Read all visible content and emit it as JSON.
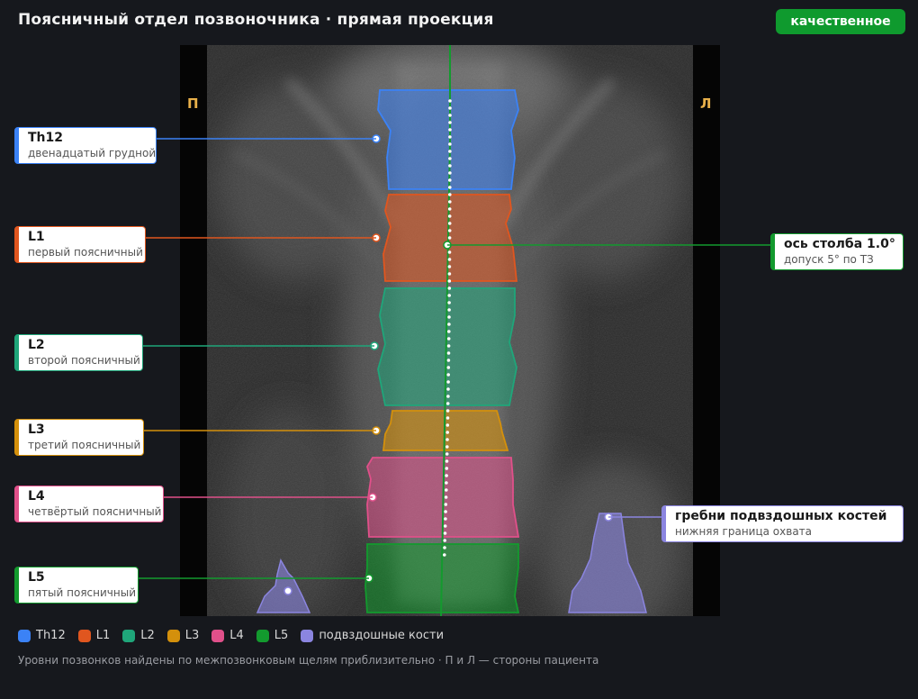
{
  "header": {
    "title": "Поясничный отдел позвоночника · прямая проекция",
    "quality_badge": "качественное"
  },
  "scan": {
    "side_right_label": "П",
    "side_left_label": "Л"
  },
  "vertebrae": [
    {
      "code": "Th12",
      "name": "двенадцатый грудной",
      "color": "#3b82f6"
    },
    {
      "code": "L1",
      "name": "первый поясничный",
      "color": "#e0561f"
    },
    {
      "code": "L2",
      "name": "второй поясничный",
      "color": "#1fa67a"
    },
    {
      "code": "L3",
      "name": "третий поясничный",
      "color": "#d4900c"
    },
    {
      "code": "L4",
      "name": "четвёртый поясничный",
      "color": "#e0508a"
    },
    {
      "code": "L5",
      "name": "пятый поясничный",
      "color": "#139a2e"
    }
  ],
  "axis_callout": {
    "title": "ось столба 1.0°",
    "subtitle": "допуск 5° по ТЗ",
    "color": "#139a2e"
  },
  "iliac_callout": {
    "title": "гребни подвздошных костей",
    "subtitle": "нижняя граница охвата",
    "color": "#8b85e0"
  },
  "legend": [
    {
      "label": "Th12",
      "color": "#3b82f6"
    },
    {
      "label": "L1",
      "color": "#e0561f"
    },
    {
      "label": "L2",
      "color": "#1fa67a"
    },
    {
      "label": "L3",
      "color": "#d4900c"
    },
    {
      "label": "L4",
      "color": "#e0508a"
    },
    {
      "label": "L5",
      "color": "#139a2e"
    },
    {
      "label": "подвздошные кости",
      "color": "#8b85e0"
    }
  ],
  "footnote": "Уровни позвонков найдены по межпозвонковым щелям приблизительно · П и Л — стороны пациента"
}
